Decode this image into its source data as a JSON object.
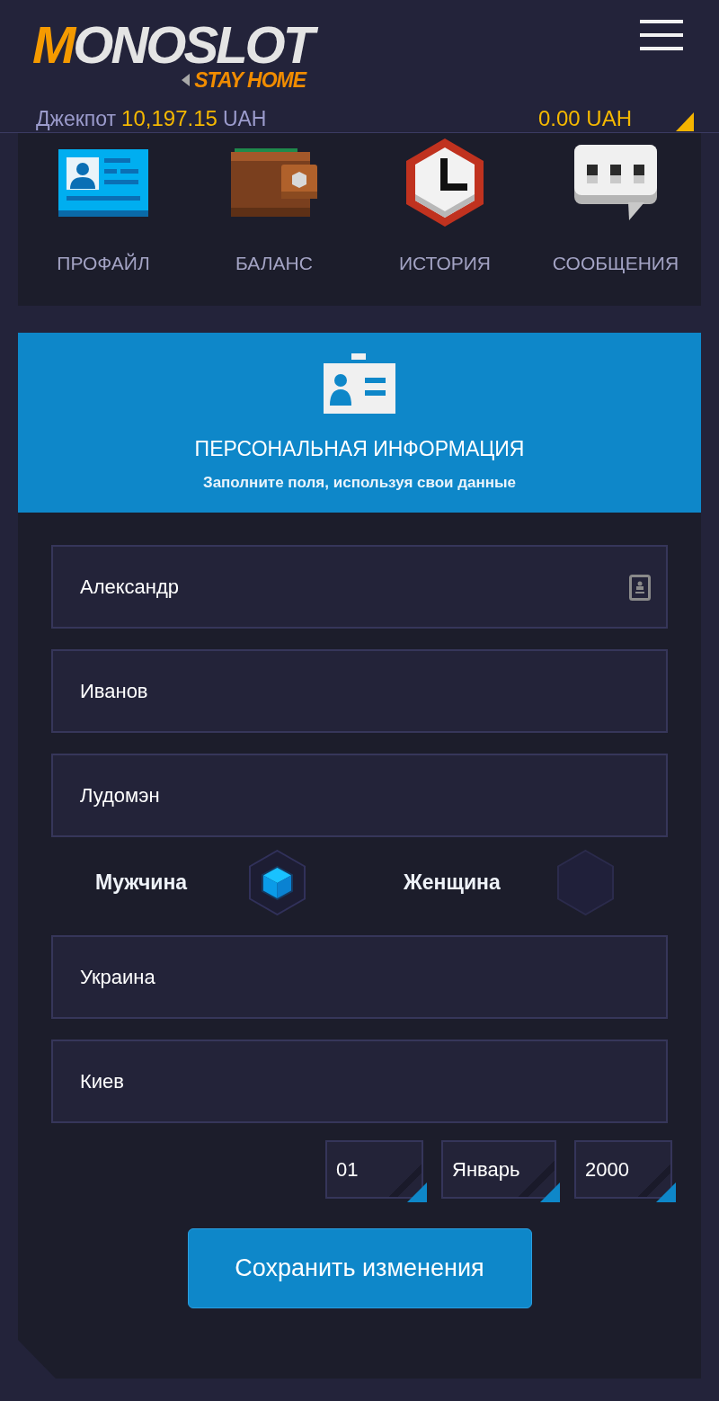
{
  "header": {
    "logo": {
      "name": "MONOSLOT",
      "tagline": "STAY HOME"
    },
    "jackpot": {
      "label": "Джекпот",
      "amount": "10,197.15",
      "currency": "UAH"
    },
    "balance": "0.00 UAH"
  },
  "nav": [
    {
      "label": "ПРОФАЙЛ",
      "kind": "profile"
    },
    {
      "label": "БАЛАНС",
      "kind": "wallet"
    },
    {
      "label": "ИСТОРИЯ",
      "kind": "history"
    },
    {
      "label": "СООБЩЕНИЯ",
      "kind": "messages"
    }
  ],
  "section": {
    "title": "ПЕРСОНАЛЬНАЯ ИНФОРМАЦИЯ",
    "subtitle": "Заполните поля, используя свои данные"
  },
  "fields": [
    {
      "value": "Александр",
      "kind": "autofill"
    },
    {
      "value": "Иванов",
      "kind": "plain"
    },
    {
      "value": "Лудомэн",
      "kind": "plain"
    }
  ],
  "gender_options": [
    {
      "label": "Мужчина",
      "selected": true
    },
    {
      "label": "Женщина",
      "selected": false
    }
  ],
  "location_fields": [
    {
      "value": "Украина"
    },
    {
      "value": "Киев"
    }
  ],
  "birth_date": [
    {
      "value": "01"
    },
    {
      "value": "Январь"
    },
    {
      "value": "2000"
    }
  ],
  "save_button": "Сохранить изменения"
}
